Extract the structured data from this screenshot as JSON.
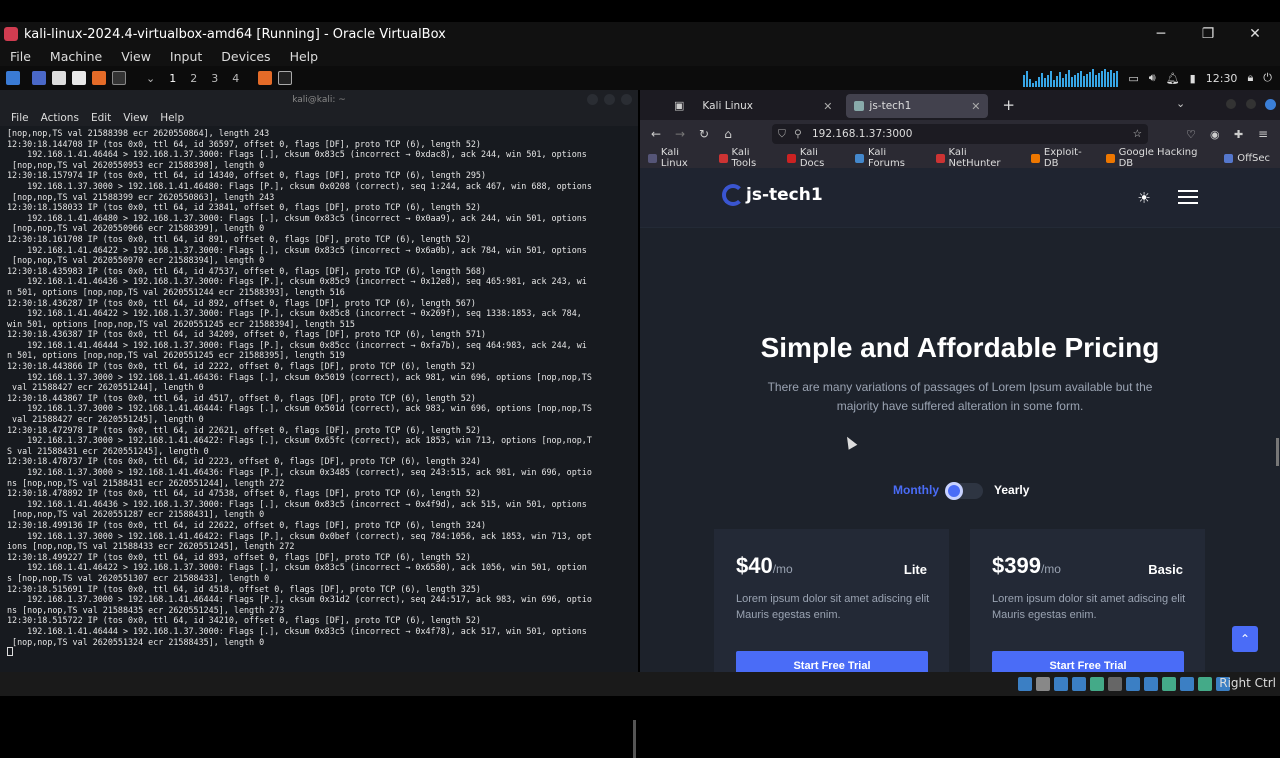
{
  "window": {
    "title": "kali-linux-2024.4-virtualbox-amd64 [Running] - Oracle VirtualBox",
    "min": "─",
    "max": "❐",
    "close": "✕"
  },
  "vb_menu": [
    "File",
    "Machine",
    "View",
    "Input",
    "Devices",
    "Help"
  ],
  "panel": {
    "workspaces": [
      "1",
      "2",
      "3",
      "4"
    ],
    "clock": "12:30"
  },
  "terminal": {
    "title": "kali@kali: ~",
    "menu": [
      "File",
      "Actions",
      "Edit",
      "View",
      "Help"
    ],
    "lines": [
      "[nop,nop,TS val 21588398 ecr 2620550864], length 243",
      "12:30:18.144708 IP (tos 0x0, ttl 64, id 36597, offset 0, flags [DF], proto TCP (6), length 52)",
      "    192.168.1.41.46464 > 192.168.1.37.3000: Flags [.], cksum 0x83c5 (incorrect → 0xdac8), ack 244, win 501, options",
      " [nop,nop,TS val 2620550953 ecr 21588398], length 0",
      "12:30:18.157974 IP (tos 0x0, ttl 64, id 14340, offset 0, flags [DF], proto TCP (6), length 295)",
      "    192.168.1.37.3000 > 192.168.1.41.46480: Flags [P.], cksum 0x0208 (correct), seq 1:244, ack 467, win 688, options",
      " [nop,nop,TS val 21588399 ecr 2620550863], length 243",
      "12:30:18.158033 IP (tos 0x0, ttl 64, id 23841, offset 0, flags [DF], proto TCP (6), length 52)",
      "    192.168.1.41.46480 > 192.168.1.37.3000: Flags [.], cksum 0x83c5 (incorrect → 0x0aa9), ack 244, win 501, options",
      " [nop,nop,TS val 2620550966 ecr 21588399], length 0",
      "12:30:18.161708 IP (tos 0x0, ttl 64, id 891, offset 0, flags [DF], proto TCP (6), length 52)",
      "    192.168.1.41.46422 > 192.168.1.37.3000: Flags [.], cksum 0x83c5 (incorrect → 0x6a0b), ack 784, win 501, options",
      " [nop,nop,TS val 2620550970 ecr 21588394], length 0",
      "12:30:18.435983 IP (tos 0x0, ttl 64, id 47537, offset 0, flags [DF], proto TCP (6), length 568)",
      "    192.168.1.41.46436 > 192.168.1.37.3000: Flags [P.], cksum 0x85c9 (incorrect → 0x12e8), seq 465:981, ack 243, wi",
      "n 501, options [nop,nop,TS val 2620551244 ecr 21588393], length 516",
      "12:30:18.436287 IP (tos 0x0, ttl 64, id 892, offset 0, flags [DF], proto TCP (6), length 567)",
      "    192.168.1.41.46422 > 192.168.1.37.3000: Flags [P.], cksum 0x85c8 (incorrect → 0x269f), seq 1338:1853, ack 784,",
      "win 501, options [nop,nop,TS val 2620551245 ecr 21588394], length 515",
      "12:30:18.436387 IP (tos 0x0, ttl 64, id 34209, offset 0, flags [DF], proto TCP (6), length 571)",
      "    192.168.1.41.46444 > 192.168.1.37.3000: Flags [P.], cksum 0x85cc (incorrect → 0xfa7b), seq 464:983, ack 244, wi",
      "n 501, options [nop,nop,TS val 2620551245 ecr 21588395], length 519",
      "12:30:18.443866 IP (tos 0x0, ttl 64, id 2222, offset 0, flags [DF], proto TCP (6), length 52)",
      "    192.168.1.37.3000 > 192.168.1.41.46436: Flags [.], cksum 0x5019 (correct), ack 981, win 696, options [nop,nop,TS",
      " val 21588427 ecr 2620551244], length 0",
      "12:30:18.443867 IP (tos 0x0, ttl 64, id 4517, offset 0, flags [DF], proto TCP (6), length 52)",
      "    192.168.1.37.3000 > 192.168.1.41.46444: Flags [.], cksum 0x501d (correct), ack 983, win 696, options [nop,nop,TS",
      " val 21588427 ecr 2620551245], length 0",
      "12:30:18.472978 IP (tos 0x0, ttl 64, id 22621, offset 0, flags [DF], proto TCP (6), length 52)",
      "    192.168.1.37.3000 > 192.168.1.41.46422: Flags [.], cksum 0x65fc (correct), ack 1853, win 713, options [nop,nop,T",
      "S val 21588431 ecr 2620551245], length 0",
      "12:30:18.478737 IP (tos 0x0, ttl 64, id 2223, offset 0, flags [DF], proto TCP (6), length 324)",
      "    192.168.1.37.3000 > 192.168.1.41.46436: Flags [P.], cksum 0x3485 (correct), seq 243:515, ack 981, win 696, optio",
      "ns [nop,nop,TS val 21588431 ecr 2620551244], length 272",
      "12:30:18.478892 IP (tos 0x0, ttl 64, id 47538, offset 0, flags [DF], proto TCP (6), length 52)",
      "    192.168.1.41.46436 > 192.168.1.37.3000: Flags [.], cksum 0x83c5 (incorrect → 0x4f9d), ack 515, win 501, options",
      " [nop,nop,TS val 2620551287 ecr 21588431], length 0",
      "12:30:18.499136 IP (tos 0x0, ttl 64, id 22622, offset 0, flags [DF], proto TCP (6), length 324)",
      "    192.168.1.37.3000 > 192.168.1.41.46422: Flags [P.], cksum 0x0bef (correct), seq 784:1056, ack 1853, win 713, opt",
      "ions [nop,nop,TS val 21588433 ecr 2620551245], length 272",
      "12:30:18.499227 IP (tos 0x0, ttl 64, id 893, offset 0, flags [DF], proto TCP (6), length 52)",
      "    192.168.1.41.46422 > 192.168.1.37.3000: Flags [.], cksum 0x83c5 (incorrect → 0x6580), ack 1056, win 501, option",
      "s [nop,nop,TS val 2620551307 ecr 21588433], length 0",
      "12:30:18.515691 IP (tos 0x0, ttl 64, id 4518, offset 0, flags [DF], proto TCP (6), length 325)",
      "    192.168.1.37.3000 > 192.168.1.41.46444: Flags [P.], cksum 0x31d2 (correct), seq 244:517, ack 983, win 696, optio",
      "ns [nop,nop,TS val 21588435 ecr 2620551245], length 273",
      "12:30:18.515722 IP (tos 0x0, ttl 64, id 34210, offset 0, flags [DF], proto TCP (6), length 52)",
      "    192.168.1.41.46444 > 192.168.1.37.3000: Flags [.], cksum 0x83c5 (incorrect → 0x4f78), ack 517, win 501, options",
      " [nop,nop,TS val 2620551324 ecr 21588435], length 0"
    ]
  },
  "browser": {
    "tabs": [
      {
        "label": "Kali Linux",
        "close": "✕"
      },
      {
        "label": "js-tech1",
        "close": "✕"
      }
    ],
    "new_tab": "+",
    "url": "192.168.1.37:3000",
    "bookmarks": [
      "Kali Linux",
      "Kali Tools",
      "Kali Docs",
      "Kali Forums",
      "Kali NetHunter",
      "Exploit-DB",
      "Google Hacking DB",
      "OffSec"
    ]
  },
  "site": {
    "logo": "js-tech1",
    "title": "Simple and Affordable Pricing",
    "subtitle": "There are many variations of passages of Lorem Ipsum available but the majority have suffered alteration in some form.",
    "monthly": "Monthly",
    "yearly": "Yearly",
    "plans": [
      {
        "price": "$40",
        "per": "/mo",
        "name": "Lite",
        "desc": "Lorem ipsum dolor sit amet adiscing elit Mauris egestas enim.",
        "cta": "Start Free Trial"
      },
      {
        "price": "$399",
        "per": "/mo",
        "name": "Basic",
        "desc": "Lorem ipsum dolor sit amet adiscing elit Mauris egestas enim.",
        "cta": "Start Free Trial"
      }
    ]
  },
  "statusbar": {
    "host_key": "Right Ctrl"
  },
  "colors": {
    "accent": "#4a6cf7",
    "terminal_bg": "#171a1f",
    "page_bg": "#1d222b"
  }
}
